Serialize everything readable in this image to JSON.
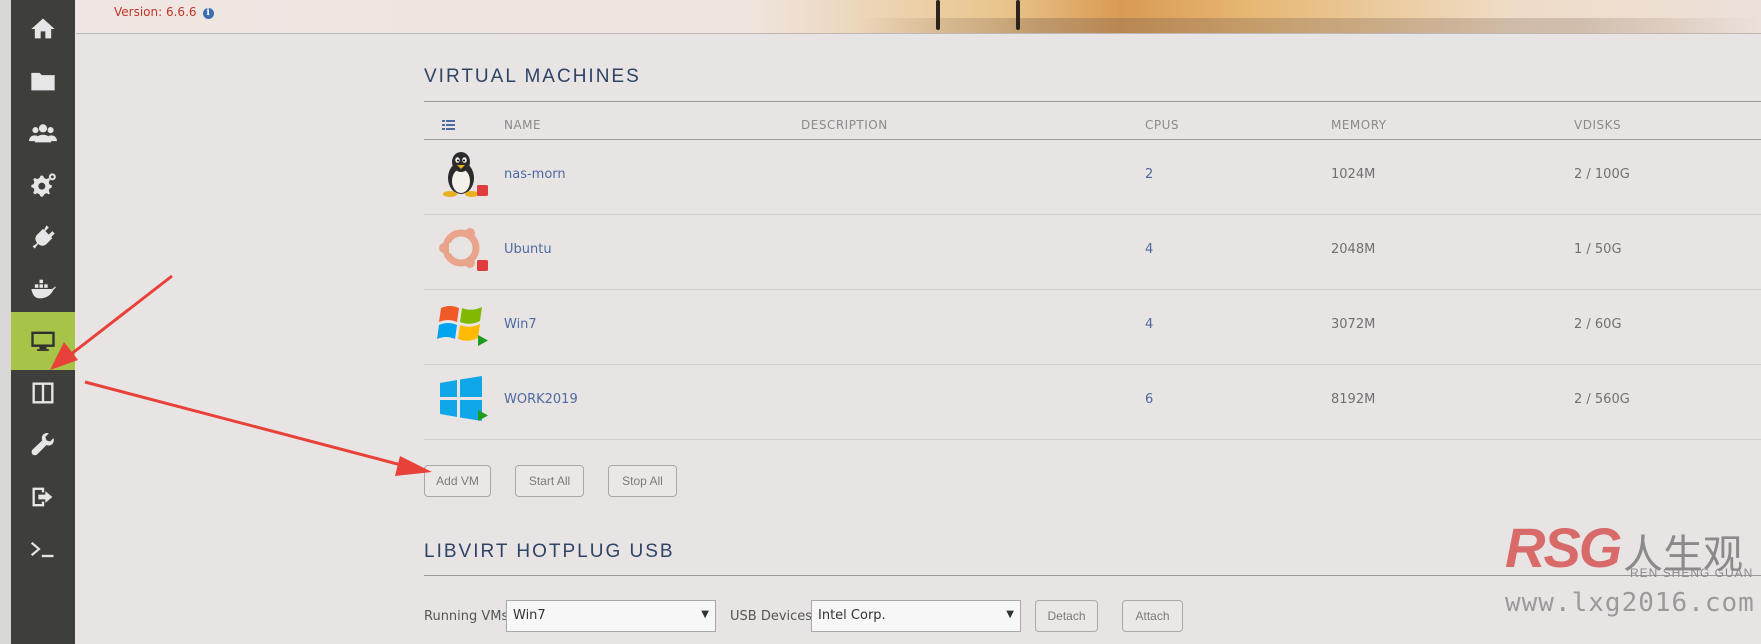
{
  "header": {
    "version_label": "Version: 6.6.6",
    "info_icon": "info-icon"
  },
  "sidebar": {
    "items": [
      {
        "name": "home",
        "icon": "home-icon"
      },
      {
        "name": "shares",
        "icon": "folder-icon"
      },
      {
        "name": "users",
        "icon": "users-icon"
      },
      {
        "name": "settings",
        "icon": "gears-icon"
      },
      {
        "name": "plugins",
        "icon": "plug-icon"
      },
      {
        "name": "docker",
        "icon": "docker-icon"
      },
      {
        "name": "vms",
        "icon": "monitor-icon",
        "active": true
      },
      {
        "name": "apps",
        "icon": "columns-icon"
      },
      {
        "name": "tools",
        "icon": "wrench-icon"
      },
      {
        "name": "logout",
        "icon": "logout-icon"
      },
      {
        "name": "terminal",
        "icon": "terminal-icon"
      }
    ],
    "active_color": "#a7c449"
  },
  "vm_section": {
    "title": "VIRTUAL MACHINES",
    "columns": [
      "NAME",
      "DESCRIPTION",
      "CPUS",
      "MEMORY",
      "VDISKS"
    ],
    "rows": [
      {
        "name": "nas-morn",
        "description": "",
        "cpus": "2",
        "memory": "1024M",
        "vdisks": "2 / 100G",
        "os": "linux-tux-icon",
        "state": "stopped"
      },
      {
        "name": "Ubuntu",
        "description": "",
        "cpus": "4",
        "memory": "2048M",
        "vdisks": "1 / 50G",
        "os": "ubuntu-icon",
        "state": "stopped"
      },
      {
        "name": "Win7",
        "description": "",
        "cpus": "4",
        "memory": "3072M",
        "vdisks": "2 / 60G",
        "os": "windows7-icon",
        "state": "running"
      },
      {
        "name": "WORK2019",
        "description": "",
        "cpus": "6",
        "memory": "8192M",
        "vdisks": "2 / 560G",
        "os": "windows10-icon",
        "state": "running"
      }
    ],
    "buttons": {
      "add": "Add VM",
      "start_all": "Start All",
      "stop_all": "Stop All"
    }
  },
  "usb_section": {
    "title": "LIBVIRT HOTPLUG USB",
    "running_vms_label": "Running VMs:",
    "running_vms_value": "Win7",
    "usb_devices_label": "USB Devices:",
    "usb_devices_value": "Intel Corp.",
    "detach_label": "Detach",
    "attach_label": "Attach"
  },
  "watermark": {
    "logo": "RSG",
    "chinese": "人生观",
    "pinyin": "REN SHENG GUAN",
    "url": "www.lxg2016.com"
  },
  "colors": {
    "stopped": "#e03c3c",
    "running": "#1f9b1f",
    "link": "#4d6aa0",
    "title": "#2d4466",
    "arrow": "#e8413a"
  }
}
